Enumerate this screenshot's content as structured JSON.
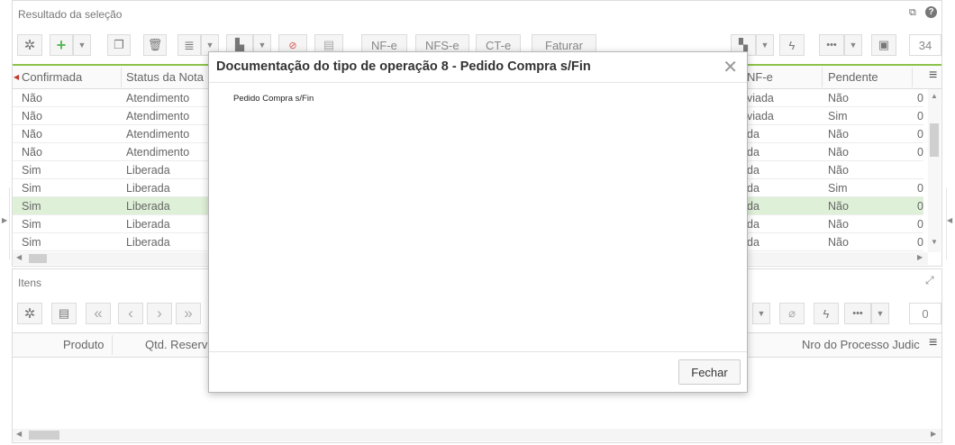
{
  "top_panel": {
    "title": "Resultado da seleção",
    "toolbar": {
      "nfe_label": "NF-e",
      "nfse_label": "NFS-e",
      "cte_label": "CT-e",
      "faturar_label": "Faturar",
      "page_count": "34"
    },
    "columns": {
      "confirmada": "Confirmada",
      "status": "Status da Nota",
      "nfe": "NF-e",
      "pendente": "Pendente"
    },
    "rows": [
      {
        "confirmada": "Não",
        "status": "Atendimento",
        "nfe": "viada",
        "pendente": "Não",
        "last": "0"
      },
      {
        "confirmada": "Não",
        "status": "Atendimento",
        "nfe": "viada",
        "pendente": "Sim",
        "last": "0"
      },
      {
        "confirmada": "Não",
        "status": "Atendimento",
        "nfe": "da",
        "pendente": "Não",
        "last": "0"
      },
      {
        "confirmada": "Não",
        "status": "Atendimento",
        "nfe": "da",
        "pendente": "Não",
        "last": "0"
      },
      {
        "confirmada": "Sim",
        "status": "Liberada",
        "nfe": "da",
        "pendente": "Não",
        "last": ""
      },
      {
        "confirmada": "Sim",
        "status": "Liberada",
        "nfe": "da",
        "pendente": "Sim",
        "last": "0"
      },
      {
        "confirmada": "Sim",
        "status": "Liberada",
        "nfe": "da",
        "pendente": "Não",
        "last": "0"
      },
      {
        "confirmada": "Sim",
        "status": "Liberada",
        "nfe": "da",
        "pendente": "Não",
        "last": "0"
      },
      {
        "confirmada": "Sim",
        "status": "Liberada",
        "nfe": "da",
        "pendente": "Não",
        "last": "0"
      }
    ],
    "selected_row_index": 6
  },
  "bottom_panel": {
    "title": "Itens",
    "page_count": "0",
    "columns": {
      "produto": "Produto",
      "qtd": "Qtd. Reserv",
      "nro": "Nro do Processo Judic"
    }
  },
  "modal": {
    "title": "Documentação do tipo de operação 8 - Pedido Compra s/Fin",
    "body_text": "Pedido Compra s/Fin",
    "close_symbol": "✕",
    "fechar_label": "Fechar"
  },
  "colors": {
    "accent_green": "#4caf50",
    "selected_row": "#dff0d8",
    "border": "#dcdcdc"
  },
  "icons": [
    "gear-icon",
    "plus-icon",
    "copy-icon",
    "trash-icon",
    "list-icon",
    "print-icon",
    "cancel-icon",
    "doc-icon",
    "export-icon",
    "lightning-icon",
    "more-icon",
    "save-icon",
    "help-icon",
    "restore-icon",
    "expand-icon",
    "first-page-icon",
    "prev-page-icon",
    "next-page-icon",
    "last-page-icon",
    "clip-icon",
    "menu-icon"
  ]
}
